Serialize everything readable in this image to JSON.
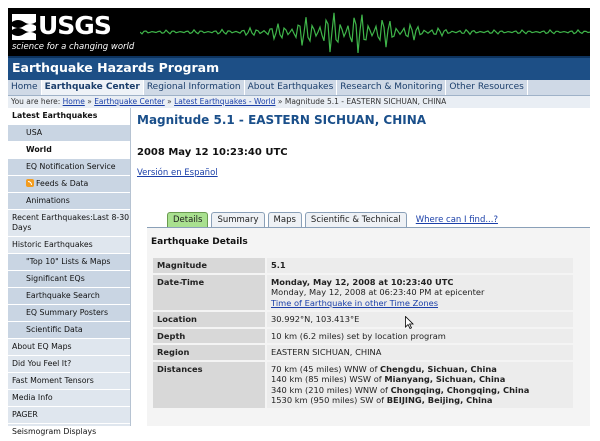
{
  "brand": {
    "logo_text": "USGS",
    "tagline": "science for a changing world"
  },
  "program_title": "Earthquake Hazards Program",
  "nav": {
    "items": [
      {
        "label": "Home"
      },
      {
        "label": "Earthquake Center",
        "active": true
      },
      {
        "label": "Regional Information"
      },
      {
        "label": "About Earthquakes"
      },
      {
        "label": "Research & Monitoring"
      },
      {
        "label": "Other Resources"
      }
    ]
  },
  "breadcrumb": {
    "prefix": "You are here:",
    "links": [
      "Home",
      "Earthquake Center",
      "Latest Earthquakes - World"
    ],
    "current": "Magnitude 5.1 - EASTERN SICHUAN, CHINA",
    "separator": "»"
  },
  "sidebar": {
    "items": [
      {
        "label": "Latest Earthquakes",
        "type": "head"
      },
      {
        "label": "USA",
        "type": "sub"
      },
      {
        "label": "World",
        "type": "sub",
        "selected": true
      },
      {
        "label": "EQ Notification Service",
        "type": "sub"
      },
      {
        "label": "Feeds & Data",
        "type": "sub",
        "icon": "rss-icon"
      },
      {
        "label": "Animations",
        "type": "sub"
      },
      {
        "label": "Recent Earthquakes:Last 8-30 Days",
        "type": "top"
      },
      {
        "label": "Historic Earthquakes",
        "type": "top"
      },
      {
        "label": "\"Top 10\" Lists & Maps",
        "type": "sub"
      },
      {
        "label": "Significant EQs",
        "type": "sub"
      },
      {
        "label": "Earthquake Search",
        "type": "sub"
      },
      {
        "label": "EQ Summary Posters",
        "type": "sub"
      },
      {
        "label": "Scientific Data",
        "type": "sub"
      },
      {
        "label": "About EQ Maps",
        "type": "top"
      },
      {
        "label": "Did You Feel It?",
        "type": "top"
      },
      {
        "label": "Fast Moment Tensors",
        "type": "top"
      },
      {
        "label": "Media Info",
        "type": "top"
      },
      {
        "label": "PAGER",
        "type": "top"
      },
      {
        "label": "Seismogram Displays",
        "type": "top"
      }
    ]
  },
  "main": {
    "heading": "Magnitude 5.1 - EASTERN SICHUAN, CHINA",
    "datetime": "2008 May 12 10:23:40 UTC",
    "spanish_link": "Versión en Español",
    "tabs": [
      "Details",
      "Summary",
      "Maps",
      "Scientific & Technical"
    ],
    "active_tab": "Details",
    "help_link": "Where can I find...?",
    "details_heading": "Earthquake Details",
    "rows": {
      "magnitude": {
        "label": "Magnitude",
        "value": "5.1"
      },
      "datetime": {
        "label": "Date-Time",
        "utc": "Monday, May 12, 2008 at 10:23:40 UTC",
        "local": "Monday, May 12, 2008 at 06:23:40 PM at epicenter",
        "link": "Time of Earthquake in other Time Zones"
      },
      "location": {
        "label": "Location",
        "value": "30.992°N, 103.413°E"
      },
      "depth": {
        "label": "Depth",
        "value": "10 km (6.2 miles) set by location program"
      },
      "region": {
        "label": "Region",
        "value": "EASTERN SICHUAN, CHINA"
      },
      "distances": {
        "label": "Distances",
        "lines": [
          {
            "pre": "70 km (45 miles) WNW of ",
            "place": "Chengdu, Sichuan, China"
          },
          {
            "pre": "140 km (85 miles) WSW of ",
            "place": "Mianyang, Sichuan, China"
          },
          {
            "pre": "340 km (210 miles) WNW of ",
            "place": "Chongqing, Chongqing, China"
          },
          {
            "pre": "1530 km (950 miles) SW of ",
            "place": "BEIJING, Beijing, China"
          }
        ]
      }
    }
  },
  "colors": {
    "title_bar": "#1d4f86",
    "heading": "#1a4f8a",
    "link": "#1a3fa8",
    "active_tab": "#a9e08f",
    "seismogram": "#3fb54a"
  }
}
